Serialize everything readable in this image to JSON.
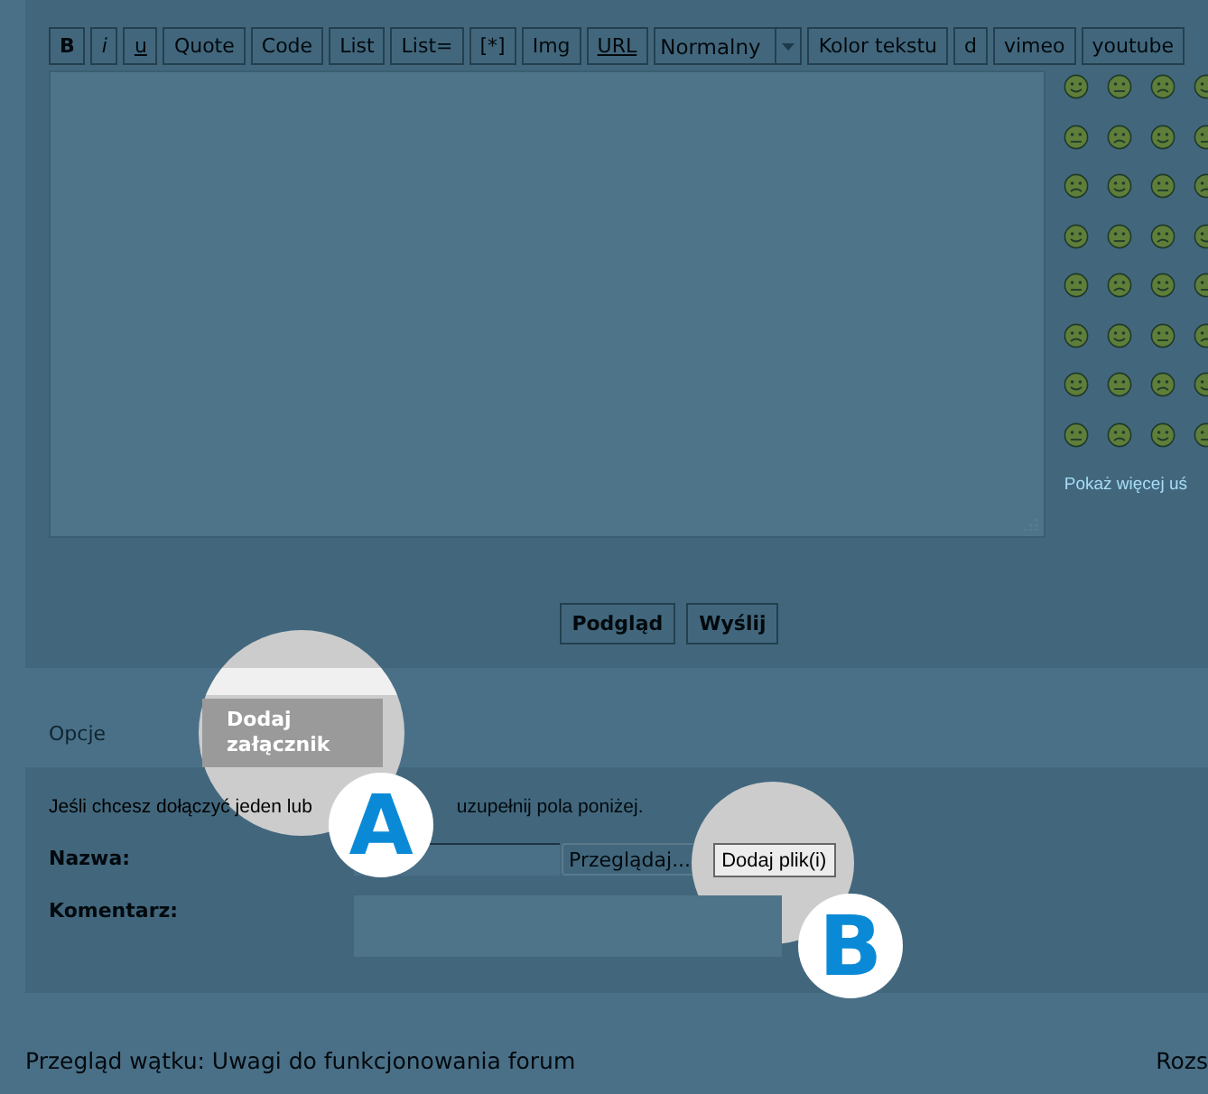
{
  "toolbar": [
    {
      "label": "B",
      "kind": "bold"
    },
    {
      "label": "i",
      "kind": "italic"
    },
    {
      "label": "u",
      "kind": "underline"
    },
    {
      "label": "Quote",
      "kind": "plain"
    },
    {
      "label": "Code",
      "kind": "plain"
    },
    {
      "label": "List",
      "kind": "plain"
    },
    {
      "label": "List=",
      "kind": "plain"
    },
    {
      "label": "[*]",
      "kind": "plain"
    },
    {
      "label": "Img",
      "kind": "plain"
    },
    {
      "label": "URL",
      "kind": "underline"
    },
    {
      "label": "Normalny",
      "kind": "dropdown"
    },
    {
      "label": "Kolor tekstu",
      "kind": "plain"
    },
    {
      "label": "d",
      "kind": "plain"
    },
    {
      "label": "vimeo",
      "kind": "plain"
    },
    {
      "label": "youtube",
      "kind": "plain"
    }
  ],
  "more_smileys_link": "Pokaż więcej uś",
  "actions": [
    "Podgląd",
    "Wyślij"
  ],
  "tabs": [
    {
      "label": "Opcje",
      "selected": false
    },
    {
      "label": "Dodaj załącznik",
      "selected": true
    }
  ],
  "attachment": {
    "intro_parts": [
      "Jeśli chcesz dołączyć jeden lub",
      "uzupełnij pola poniżej."
    ],
    "name_label": "Nazwa:",
    "browse_button": "Przeglądaj...",
    "add_button": "Dodaj plik(i)",
    "comment_label": "Komentarz:"
  },
  "callouts": [
    {
      "letter": "A"
    },
    {
      "letter": "B"
    }
  ],
  "footer": {
    "title": "Przegląd wątku: Uwagi do funkcjonowania forum",
    "right_link": "Rozs"
  }
}
